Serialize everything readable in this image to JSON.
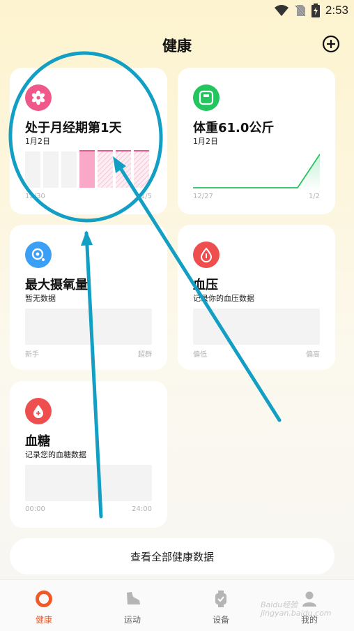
{
  "status_bar": {
    "time": "2:53"
  },
  "header": {
    "title": "健康"
  },
  "cards": {
    "period": {
      "title": "处于月经期第1天",
      "date": "1月2日",
      "axis_start": "12/30",
      "axis_end": "1/5"
    },
    "weight": {
      "title": "体重61.0公斤",
      "date": "1月2日",
      "axis_start": "12/27",
      "axis_end": "1/2"
    },
    "vo2max": {
      "title": "最大摄氧量",
      "subtitle": "暂无数据",
      "axis_start": "新手",
      "axis_end": "超群"
    },
    "blood_pressure": {
      "title": "血压",
      "subtitle": "记录你的血压数据",
      "axis_start": "偏低",
      "axis_end": "偏高"
    },
    "blood_sugar": {
      "title": "血糖",
      "subtitle": "记录您的血糖数据",
      "axis_start": "00:00",
      "axis_end": "24:00"
    }
  },
  "view_all_label": "查看全部健康数据",
  "bottom_nav": {
    "items": [
      {
        "label": "健康",
        "active": true
      },
      {
        "label": "运动",
        "active": false
      },
      {
        "label": "设备",
        "active": false
      },
      {
        "label": "我的",
        "active": false
      }
    ]
  },
  "watermark": "Baidu经验 jingyan.baidu.com",
  "colors": {
    "accent": "#f05a28",
    "period_pink": "#f9a8c8",
    "weight_green": "#22c55e",
    "annotation": "#139fc4"
  }
}
